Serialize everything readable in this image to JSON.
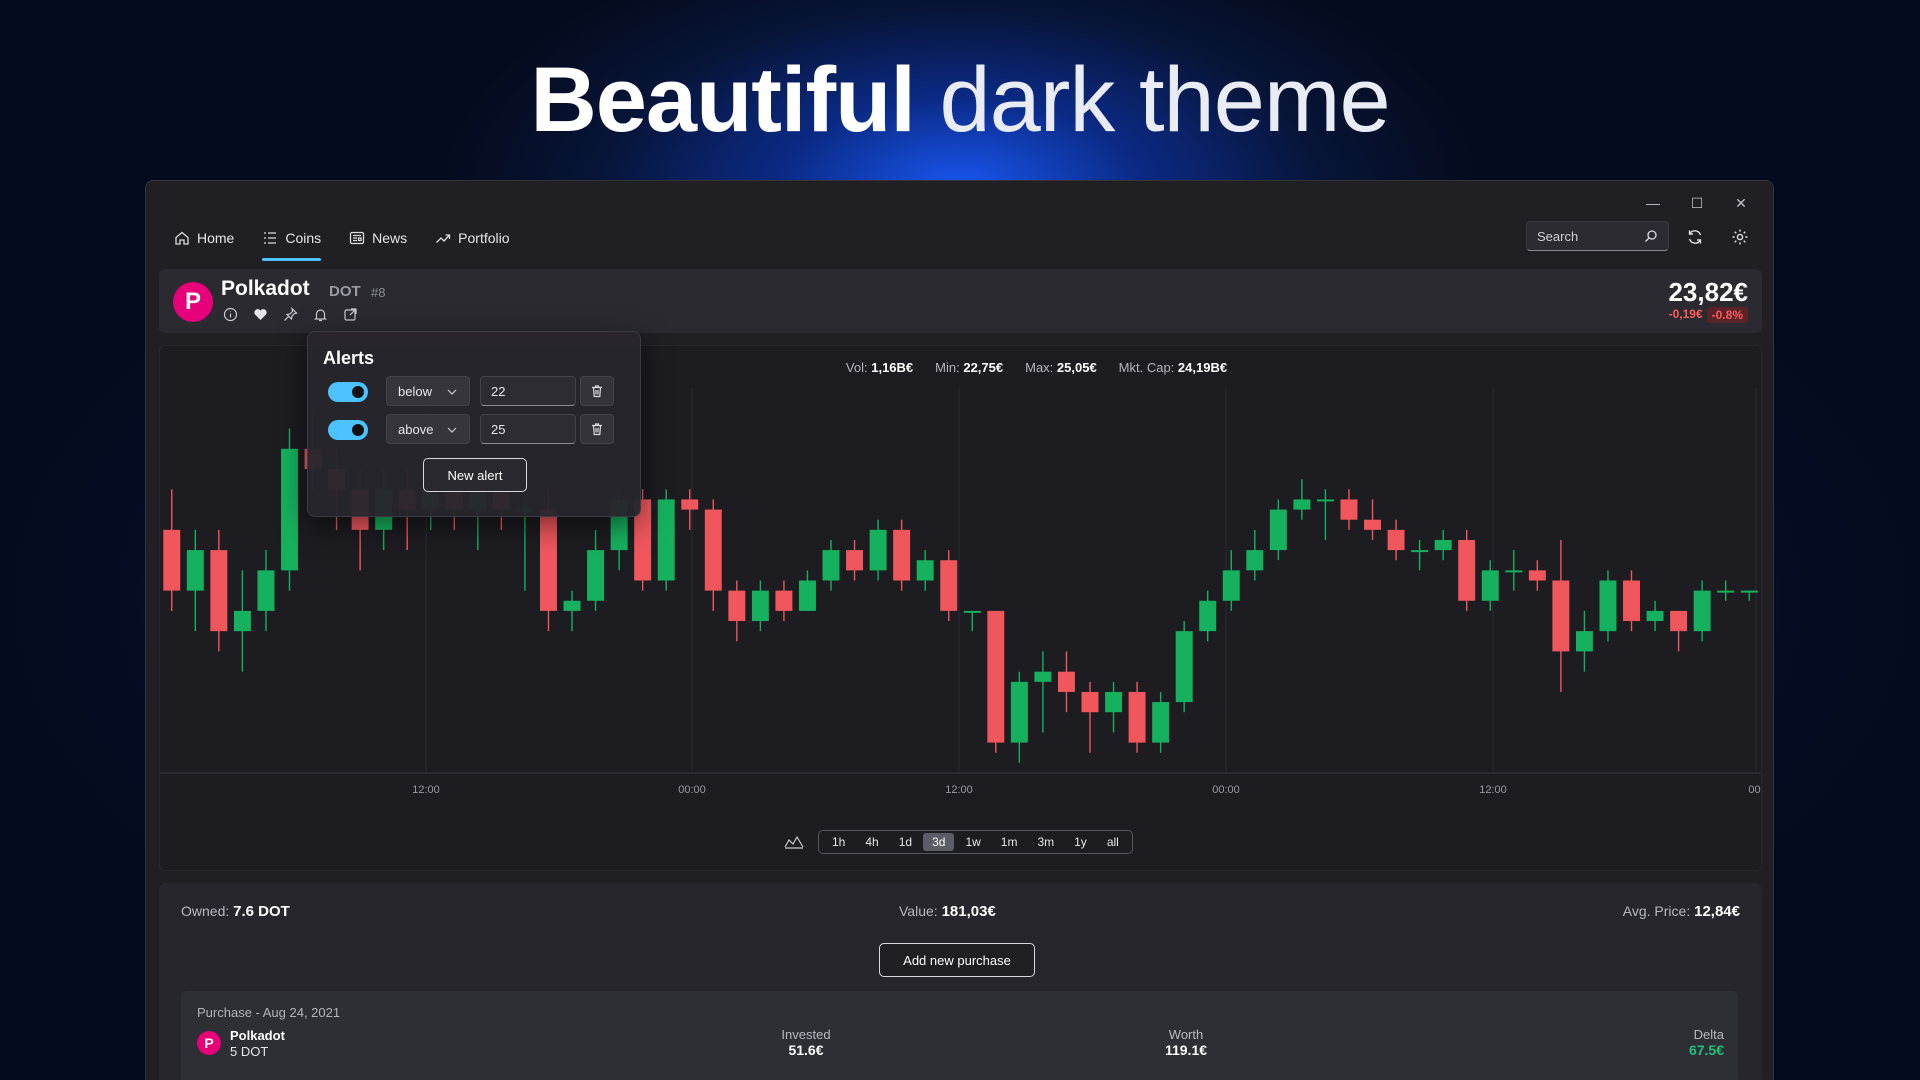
{
  "headline": {
    "bold": "Beautiful",
    "light": "dark theme"
  },
  "window_controls": {
    "minimize": "—",
    "maximize": "☐",
    "close": "✕"
  },
  "nav": {
    "items": [
      {
        "label": "Home",
        "icon": "home-icon"
      },
      {
        "label": "Coins",
        "icon": "list-icon",
        "active": true
      },
      {
        "label": "News",
        "icon": "news-icon"
      },
      {
        "label": "Portfolio",
        "icon": "trend-icon"
      }
    ]
  },
  "search": {
    "placeholder": "Search"
  },
  "coin": {
    "name": "Polkadot",
    "symbol": "DOT",
    "rank": "#8",
    "logo_letter": "P",
    "price": "23,82€",
    "change": "-0,19€",
    "change_pct": "-0.8%",
    "brand_color": "#e6007a"
  },
  "stats": {
    "vol_label": "Vol:",
    "vol": "1,16B€",
    "min_label": "Min:",
    "min": "22,75€",
    "max_label": "Max:",
    "max": "25,05€",
    "cap_label": "Mkt. Cap:",
    "cap": "24,19B€"
  },
  "chart_data": {
    "type": "candlestick",
    "x_ticks": [
      "12:00",
      "00:00",
      "12:00",
      "00:00",
      "12:00",
      "00:"
    ],
    "up_color": "#16b15e",
    "down_color": "#f0575c",
    "candles": [
      {
        "o": 24.6,
        "h": 24.8,
        "l": 24.2,
        "c": 24.3
      },
      {
        "o": 24.3,
        "h": 24.6,
        "l": 24.1,
        "c": 24.5
      },
      {
        "o": 24.5,
        "h": 24.6,
        "l": 24.0,
        "c": 24.1
      },
      {
        "o": 24.1,
        "h": 24.4,
        "l": 23.9,
        "c": 24.2
      },
      {
        "o": 24.2,
        "h": 24.5,
        "l": 24.1,
        "c": 24.4
      },
      {
        "o": 24.4,
        "h": 25.1,
        "l": 24.3,
        "c": 25.0
      },
      {
        "o": 25.0,
        "h": 25.2,
        "l": 24.8,
        "c": 24.9
      },
      {
        "o": 24.9,
        "h": 25.0,
        "l": 24.6,
        "c": 24.8
      },
      {
        "o": 24.8,
        "h": 24.9,
        "l": 24.4,
        "c": 24.6
      },
      {
        "o": 24.6,
        "h": 24.9,
        "l": 24.5,
        "c": 24.8
      },
      {
        "o": 24.8,
        "h": 24.9,
        "l": 24.5,
        "c": 24.7
      },
      {
        "o": 24.7,
        "h": 24.9,
        "l": 24.6,
        "c": 24.8
      },
      {
        "o": 24.8,
        "h": 24.9,
        "l": 24.6,
        "c": 24.7
      },
      {
        "o": 24.7,
        "h": 24.8,
        "l": 24.5,
        "c": 24.8
      },
      {
        "o": 24.8,
        "h": 24.8,
        "l": 24.6,
        "c": 24.7
      },
      {
        "o": 24.7,
        "h": 24.8,
        "l": 24.3,
        "c": 24.7
      },
      {
        "o": 24.7,
        "h": 24.8,
        "l": 24.1,
        "c": 24.2
      },
      {
        "o": 24.2,
        "h": 24.3,
        "l": 24.1,
        "c": 24.25
      },
      {
        "o": 24.25,
        "h": 24.6,
        "l": 24.2,
        "c": 24.5
      },
      {
        "o": 24.5,
        "h": 24.8,
        "l": 24.4,
        "c": 24.75
      },
      {
        "o": 24.75,
        "h": 24.8,
        "l": 24.3,
        "c": 24.35
      },
      {
        "o": 24.35,
        "h": 24.8,
        "l": 24.3,
        "c": 24.75
      },
      {
        "o": 24.75,
        "h": 24.8,
        "l": 24.6,
        "c": 24.7
      },
      {
        "o": 24.7,
        "h": 24.75,
        "l": 24.2,
        "c": 24.3
      },
      {
        "o": 24.3,
        "h": 24.35,
        "l": 24.05,
        "c": 24.15
      },
      {
        "o": 24.15,
        "h": 24.35,
        "l": 24.1,
        "c": 24.3
      },
      {
        "o": 24.3,
        "h": 24.35,
        "l": 24.15,
        "c": 24.2
      },
      {
        "o": 24.2,
        "h": 24.4,
        "l": 24.2,
        "c": 24.35
      },
      {
        "o": 24.35,
        "h": 24.55,
        "l": 24.3,
        "c": 24.5
      },
      {
        "o": 24.5,
        "h": 24.55,
        "l": 24.35,
        "c": 24.4
      },
      {
        "o": 24.4,
        "h": 24.65,
        "l": 24.35,
        "c": 24.6
      },
      {
        "o": 24.6,
        "h": 24.65,
        "l": 24.3,
        "c": 24.35
      },
      {
        "o": 24.35,
        "h": 24.5,
        "l": 24.3,
        "c": 24.45
      },
      {
        "o": 24.45,
        "h": 24.5,
        "l": 24.15,
        "c": 24.2
      },
      {
        "o": 24.2,
        "h": 24.2,
        "l": 24.1,
        "c": 24.2
      },
      {
        "o": 24.2,
        "h": 24.2,
        "l": 23.5,
        "c": 23.55
      },
      {
        "o": 23.55,
        "h": 23.9,
        "l": 23.45,
        "c": 23.85
      },
      {
        "o": 23.85,
        "h": 24.0,
        "l": 23.6,
        "c": 23.9
      },
      {
        "o": 23.9,
        "h": 24.0,
        "l": 23.7,
        "c": 23.8
      },
      {
        "o": 23.8,
        "h": 23.85,
        "l": 23.5,
        "c": 23.7
      },
      {
        "o": 23.7,
        "h": 23.85,
        "l": 23.6,
        "c": 23.8
      },
      {
        "o": 23.8,
        "h": 23.85,
        "l": 23.5,
        "c": 23.55
      },
      {
        "o": 23.55,
        "h": 23.8,
        "l": 23.5,
        "c": 23.75
      },
      {
        "o": 23.75,
        "h": 24.15,
        "l": 23.7,
        "c": 24.1
      },
      {
        "o": 24.1,
        "h": 24.3,
        "l": 24.05,
        "c": 24.25
      },
      {
        "o": 24.25,
        "h": 24.5,
        "l": 24.2,
        "c": 24.4
      },
      {
        "o": 24.4,
        "h": 24.6,
        "l": 24.35,
        "c": 24.5
      },
      {
        "o": 24.5,
        "h": 24.75,
        "l": 24.45,
        "c": 24.7
      },
      {
        "o": 24.7,
        "h": 24.85,
        "l": 24.65,
        "c": 24.75
      },
      {
        "o": 24.75,
        "h": 24.8,
        "l": 24.55,
        "c": 24.75
      },
      {
        "o": 24.75,
        "h": 24.8,
        "l": 24.6,
        "c": 24.65
      },
      {
        "o": 24.65,
        "h": 24.75,
        "l": 24.55,
        "c": 24.6
      },
      {
        "o": 24.6,
        "h": 24.65,
        "l": 24.45,
        "c": 24.5
      },
      {
        "o": 24.5,
        "h": 24.55,
        "l": 24.4,
        "c": 24.5
      },
      {
        "o": 24.5,
        "h": 24.6,
        "l": 24.45,
        "c": 24.55
      },
      {
        "o": 24.55,
        "h": 24.6,
        "l": 24.2,
        "c": 24.25
      },
      {
        "o": 24.25,
        "h": 24.45,
        "l": 24.2,
        "c": 24.4
      },
      {
        "o": 24.4,
        "h": 24.5,
        "l": 24.3,
        "c": 24.4
      },
      {
        "o": 24.4,
        "h": 24.45,
        "l": 24.3,
        "c": 24.35
      },
      {
        "o": 24.35,
        "h": 24.55,
        "l": 23.8,
        "c": 24.0
      },
      {
        "o": 24.0,
        "h": 24.2,
        "l": 23.9,
        "c": 24.1
      },
      {
        "o": 24.1,
        "h": 24.4,
        "l": 24.05,
        "c": 24.35
      },
      {
        "o": 24.35,
        "h": 24.4,
        "l": 24.1,
        "c": 24.15
      },
      {
        "o": 24.15,
        "h": 24.25,
        "l": 24.1,
        "c": 24.2
      },
      {
        "o": 24.2,
        "h": 24.2,
        "l": 24.0,
        "c": 24.1
      },
      {
        "o": 24.1,
        "h": 24.35,
        "l": 24.05,
        "c": 24.3
      },
      {
        "o": 24.3,
        "h": 24.35,
        "l": 24.25,
        "c": 24.3
      },
      {
        "o": 24.3,
        "h": 24.3,
        "l": 24.25,
        "c": 24.3
      }
    ]
  },
  "timeframes": {
    "options": [
      "1h",
      "4h",
      "1d",
      "3d",
      "1w",
      "1m",
      "3m",
      "1y",
      "all"
    ],
    "selected": "3d"
  },
  "portfolio": {
    "owned_label": "Owned:",
    "owned": "7.6 DOT",
    "value_label": "Value:",
    "value": "181,03€",
    "avg_label": "Avg. Price:",
    "avg": "12,84€",
    "add_button": "Add new purchase",
    "purchase": {
      "title": "Purchase - Aug 24, 2021",
      "coin": "Polkadot",
      "amount": "5 DOT",
      "invested_label": "Invested",
      "invested": "51.6€",
      "worth_label": "Worth",
      "worth": "119.1€",
      "delta_label": "Delta",
      "delta": "67.5€"
    }
  },
  "alerts": {
    "title": "Alerts",
    "rows": [
      {
        "enabled": true,
        "condition": "below",
        "value": "22"
      },
      {
        "enabled": true,
        "condition": "above",
        "value": "25"
      }
    ],
    "new_button": "New alert"
  }
}
